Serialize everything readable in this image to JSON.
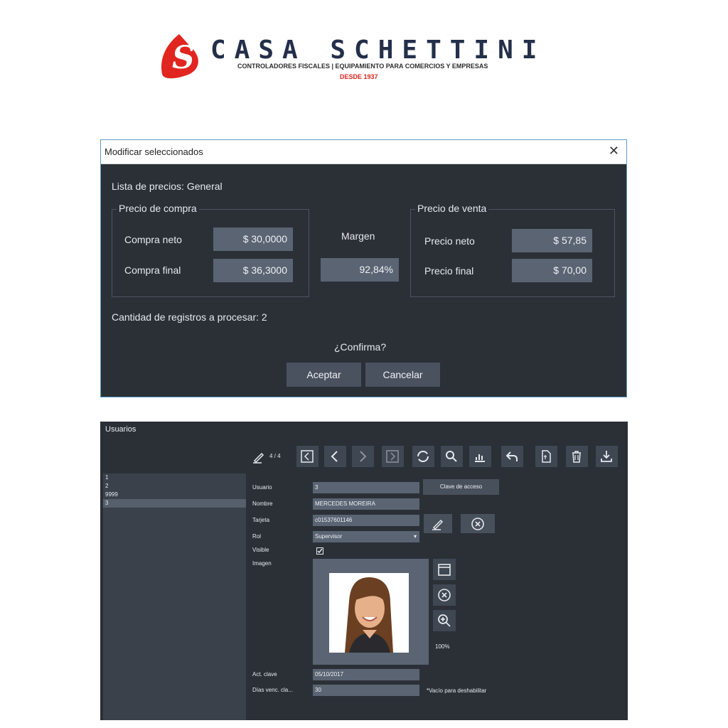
{
  "brand": {
    "name": "CASA SCHETTINI",
    "tagline": "CONTROLADORES FISCALES |  EQUIPAMIENTO PARA COMERCIOS Y EMPRESAS",
    "since": "DESDE 1937",
    "logo_letter": "S",
    "logo_color": "#e0261f",
    "name_color": "#24304a"
  },
  "dialog": {
    "title": "Modificar seleccionados",
    "close_icon": "close-icon",
    "price_list": "Lista de precios: General",
    "purchase": {
      "legend": "Precio de compra",
      "net_label": "Compra neto",
      "net_value": "$ 30,0000",
      "final_label": "Compra final",
      "final_value": "$ 36,3000"
    },
    "margin": {
      "label": "Margen",
      "value": "92,84%"
    },
    "sale": {
      "legend": "Precio de venta",
      "net_label": "Precio neto",
      "net_value": "$ 57,85",
      "final_label": "Precio final",
      "final_value": "$ 70,00"
    },
    "records": "Cantidad de registros a procesar: 2",
    "confirm": "¿Confirma?",
    "accept": "Aceptar",
    "cancel": "Cancelar"
  },
  "users": {
    "title": "Usuarios",
    "record_counter": "4 / 4",
    "toolbar_icons": [
      "edit-icon",
      "first-record-icon",
      "previous-icon",
      "next-icon",
      "last-record-icon",
      "refresh-icon",
      "search-icon",
      "chart-icon",
      "undo-icon",
      "document-icon",
      "trash-icon",
      "download-icon"
    ],
    "list": [
      "1",
      "2",
      "9999",
      "3"
    ],
    "selected_index": 3,
    "labels": {
      "usuario": "Usuario",
      "nombre": "Nombre",
      "tarjeta": "Tarjeta",
      "rol": "Rol",
      "visible": "Visible",
      "imagen": "Imagen",
      "act_clave": "Act. clave",
      "dias_venc": "Días venc. cla..."
    },
    "values": {
      "usuario": "3",
      "nombre": "MERCEDES MOREIRA",
      "tarjeta": "c01537601146",
      "rol": "Supervisor",
      "act_clave": "05/10/2017",
      "dias_venc": "30"
    },
    "visible_checked": true,
    "clave_button": "Clave de acceso",
    "zoom": "100%",
    "disable_hint": "*Vacío para deshabilitar"
  }
}
